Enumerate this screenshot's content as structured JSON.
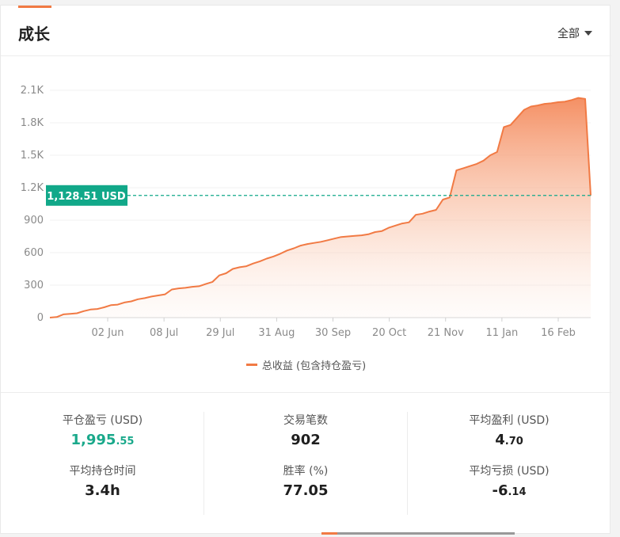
{
  "header": {
    "title": "成长",
    "filter_label": "全部"
  },
  "chart_data": {
    "type": "area",
    "ylim": [
      0,
      2100
    ],
    "y_ticks": [
      "0",
      "300",
      "600",
      "900",
      "1.2K",
      "1.5K",
      "1.8K",
      "2.1K"
    ],
    "y_tick_values": [
      0,
      300,
      600,
      900,
      1200,
      1500,
      1800,
      2100
    ],
    "x_ticks": [
      "02 Jun",
      "08 Jul",
      "29 Jul",
      "31 Aug",
      "30 Sep",
      "20 Oct",
      "21 Nov",
      "11 Jan",
      "16 Feb"
    ],
    "grid": true,
    "legend_position": "bottom-center",
    "marker_label": "1,128.51 USD",
    "marker_value": 1128.51,
    "color": "#f17a44",
    "marker_color": "#11a889",
    "series": [
      {
        "name": "总收益 (包含持仓盈亏)",
        "values": [
          0,
          5,
          30,
          35,
          40,
          60,
          75,
          80,
          95,
          115,
          120,
          140,
          150,
          170,
          180,
          195,
          205,
          215,
          260,
          270,
          275,
          285,
          290,
          310,
          330,
          390,
          410,
          450,
          465,
          475,
          500,
          520,
          545,
          565,
          590,
          620,
          640,
          665,
          680,
          690,
          700,
          715,
          730,
          745,
          750,
          755,
          760,
          770,
          790,
          800,
          830,
          850,
          870,
          880,
          950,
          960,
          980,
          995,
          1090,
          1110,
          1360,
          1380,
          1400,
          1420,
          1450,
          1500,
          1530,
          1760,
          1780,
          1850,
          1920,
          1950,
          1960,
          1975,
          1980,
          1990,
          1995,
          2010,
          2030,
          2020,
          1128.51
        ]
      }
    ]
  },
  "stats": {
    "closed_pnl": {
      "label": "平仓盈亏 (USD)",
      "int": "1,995",
      "dec": ".55"
    },
    "trades": {
      "label": "交易笔数",
      "value": "902"
    },
    "avg_profit": {
      "label": "平均盈利 (USD)",
      "int": "4",
      "dec": ".70"
    },
    "avg_hold": {
      "label": "平均持仓时间",
      "value": "3.4h"
    },
    "win_rate": {
      "label": "胜率 (%)",
      "value": "77.05"
    },
    "avg_loss": {
      "label": "平均亏损 (USD)",
      "int": "-6",
      "dec": ".14"
    }
  }
}
